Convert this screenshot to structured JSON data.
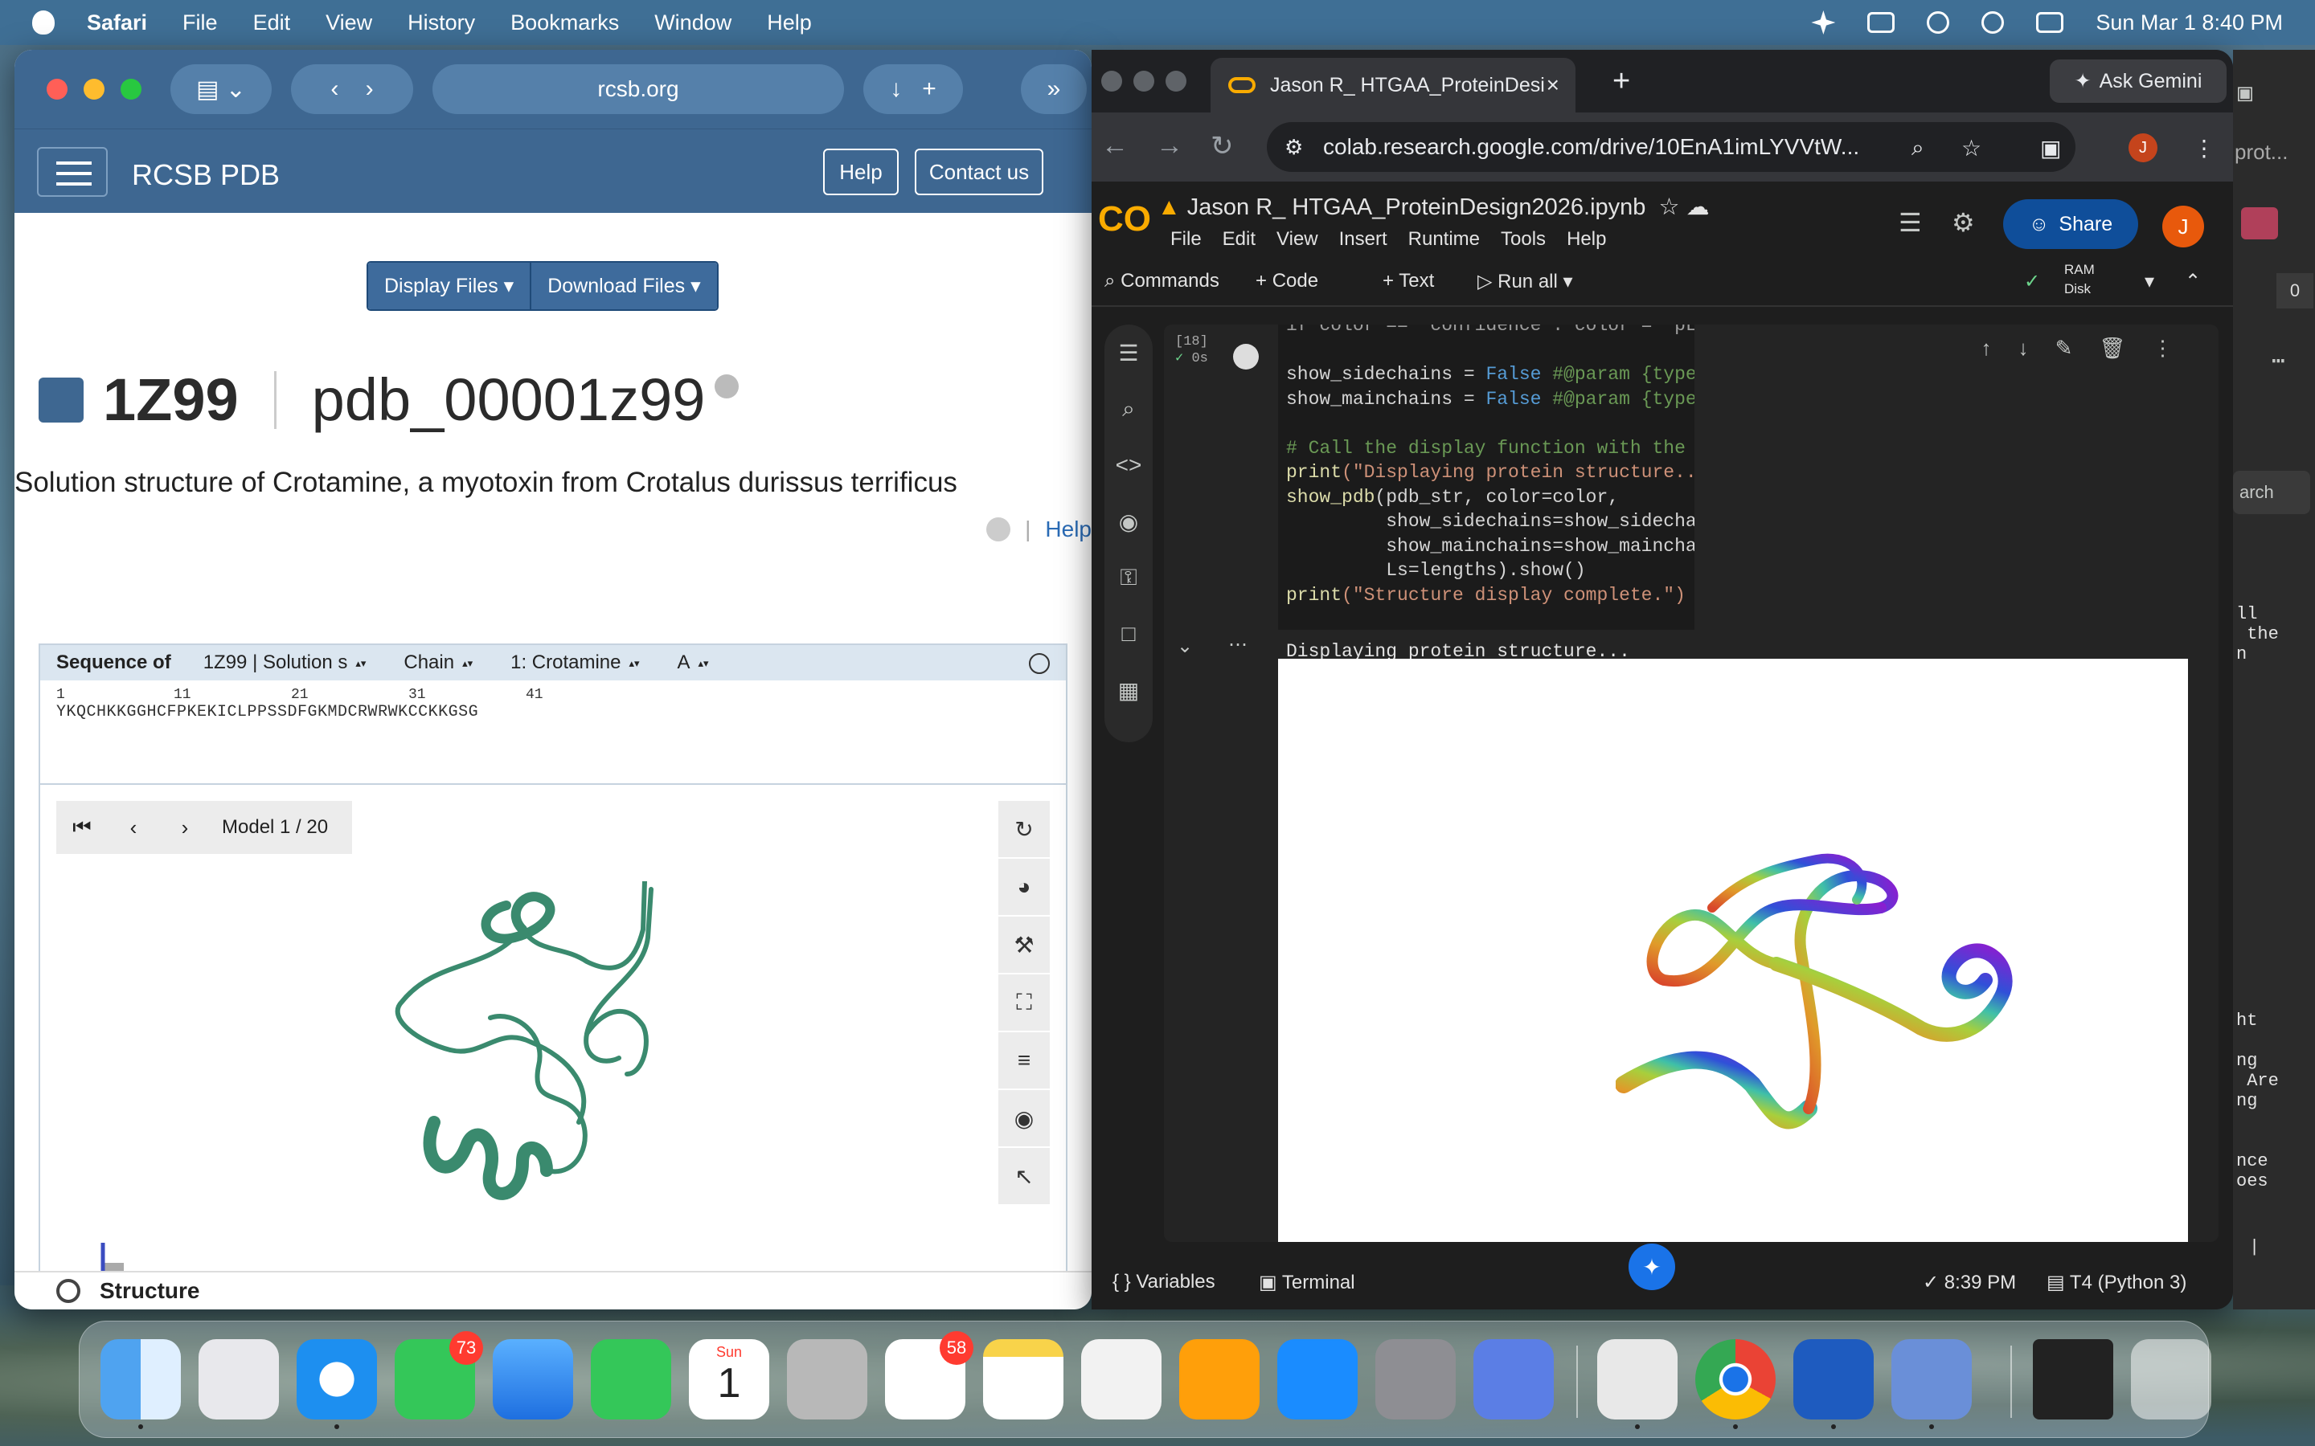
{
  "menubar": {
    "app": "Safari",
    "items": [
      "File",
      "Edit",
      "View",
      "History",
      "Bookmarks",
      "Window",
      "Help"
    ],
    "datetime": "Sun Mar 1  8:40 PM"
  },
  "safari": {
    "url": "rcsb.org",
    "site_title": "RCSB PDB",
    "help_btn": "Help",
    "contact_btn": "Contact us",
    "display_files": "Display Files",
    "download_files": "Download Files",
    "entry_id": "1Z99",
    "entry_alt_id": "pdb_00001z99",
    "entry_title": "Solution structure of Crotamine, a myotoxin from Crotalus durissus terrificus",
    "help_link": "Help",
    "sequence": {
      "label": "Sequence of",
      "entity": "1Z99 | Solution s",
      "chain_select": "Chain",
      "molecule": "1: Crotamine",
      "chain": "A",
      "nums": [
        "1",
        "11",
        "21",
        "31",
        "41"
      ],
      "residues": "YKQCHKKGGHCFPKEKICLPPSSDFGKMDCRWRWKCCKKGSG"
    },
    "model_label": "Model 1 / 20",
    "structure_label": "Structure"
  },
  "chrome": {
    "tab_title": "Jason R_ HTGAA_ProteinDesi",
    "ask_gemini": "Ask Gemini",
    "url": "colab.research.google.com/drive/10EnA1imLYVVtW...",
    "profile_initial": "J"
  },
  "colab": {
    "notebook_title": "Jason R_ HTGAA_ProteinDesign2026.ipynb",
    "menu": [
      "File",
      "Edit",
      "View",
      "Insert",
      "Runtime",
      "Tools",
      "Help"
    ],
    "share": "Share",
    "avatar": "J",
    "toolbar": {
      "commands": "Commands",
      "code": "Code",
      "text": "Text",
      "run_all": "Run all",
      "ram": "RAM",
      "disk": "Disk"
    },
    "cell_number": "[18]",
    "cell_time": "0s",
    "code_lines": {
      "l0": "if color == \"confidence\": color = \"pLDI",
      "l1a": "show_sidechains = ",
      "l1b": "False",
      "l1c": " #@param {type:'",
      "l2a": "show_mainchains = ",
      "l2b": "False",
      "l2c": " #@param {type:'",
      "l3": "# Call the display function with the g",
      "l4a": "print",
      "l4b": "(\"Displaying protein structure...\"",
      "l5a": "show_pdb",
      "l5b": "(pdb_str, color=color,",
      "l6": "         show_sidechains=show_sidechai",
      "l7": "         show_mainchains=show_mainchai",
      "l8": "         Ls=lengths).show()",
      "l9a": "print",
      "l9b": "(\"Structure display complete.\")"
    },
    "output_text": "Displaying protein structure...",
    "footer": {
      "variables": "Variables",
      "terminal": "Terminal",
      "time": "8:39 PM",
      "runtime": "T4 (Python 3)"
    }
  },
  "partial_window": {
    "search": "arch",
    "prot": "prot...",
    "count": "0",
    "text1": "ll\n the\nn",
    "text2": "ht\n\nng\n Are\nng\n\n\nnce\noes",
    "bar": "|"
  },
  "dock": {
    "messages_badge": "73",
    "reminders_badge": "58",
    "calendar_day": "Sun",
    "calendar_date": "1"
  }
}
